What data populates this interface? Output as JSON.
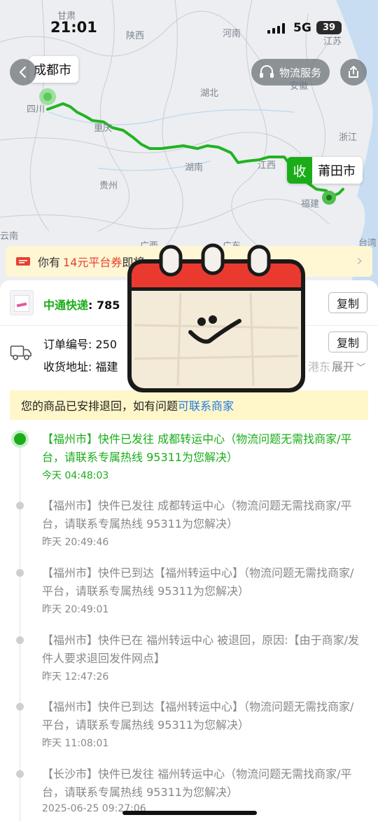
{
  "status_bar": {
    "time": "21:01",
    "network": "5G",
    "battery": "39"
  },
  "map": {
    "provinces": [
      "甘肃",
      "陕西",
      "河南",
      "江苏",
      "安徽",
      "湖北",
      "四川",
      "重庆",
      "浙江",
      "湖南",
      "江西",
      "贵州",
      "福建",
      "云南",
      "广西",
      "广东",
      "台湾"
    ],
    "origin": {
      "label": "成都市"
    },
    "destination": {
      "badge": "收",
      "label": "莆田市"
    },
    "route_color": "#22b322"
  },
  "header": {
    "back_icon": "back-arrow-icon",
    "service_label": "物流服务",
    "share_icon": "share-icon"
  },
  "coupon": {
    "prefix": "你有",
    "amount": "14元平台券",
    "suffix": "即将",
    "icon": "ticket-icon",
    "arrow": "›"
  },
  "courier": {
    "name": "中通快递",
    "tracking_partial": ": 785",
    "copy_label": "复制"
  },
  "order": {
    "order_label": "订单编号: 250",
    "address_label": "收货地址: 福建",
    "address_tail": "港东",
    "expand_label": "展开",
    "copy_label": "复制",
    "truck_icon": "truck-icon"
  },
  "notice": {
    "text": "您的商品已安排退回，如有问题",
    "link": "可联系商家"
  },
  "events": [
    {
      "desc": "【福州市】快件已发往 成都转运中心（物流问题无需找商家/平台，请联系专属热线 95311为您解决）",
      "time": "今天 04:48:03"
    },
    {
      "desc": "【福州市】快件已发往 成都转运中心（物流问题无需找商家/平台，请联系专属热线 95311为您解决）",
      "time": "昨天 20:49:46"
    },
    {
      "desc": "【福州市】快件已到达【福州转运中心】（物流问题无需找商家/平台，请联系专属热线 95311为您解决）",
      "time": "昨天 20:49:01"
    },
    {
      "desc": "【福州市】快件已在 福州转运中心 被退回，原因:【由于商家/发件人要求退回发件网点】",
      "time": "昨天 12:47:26"
    },
    {
      "desc": "【福州市】快件已到达【福州转运中心】（物流问题无需找商家/平台，请联系专属热线 95311为您解决）",
      "time": "昨天 11:08:01"
    },
    {
      "desc": "【长沙市】快件已发往 福州转运中心（物流问题无需找商家/平台，请联系专属热线 95311为您解决）",
      "time": "2025-06-25 09:27:06"
    }
  ],
  "overlay": {
    "sticker": "calendar-sticker"
  },
  "colors": {
    "accent_green": "#1aad19",
    "coupon_red": "#e8412f",
    "link_blue": "#1f7ae0",
    "notice_bg": "#fff6c9"
  }
}
